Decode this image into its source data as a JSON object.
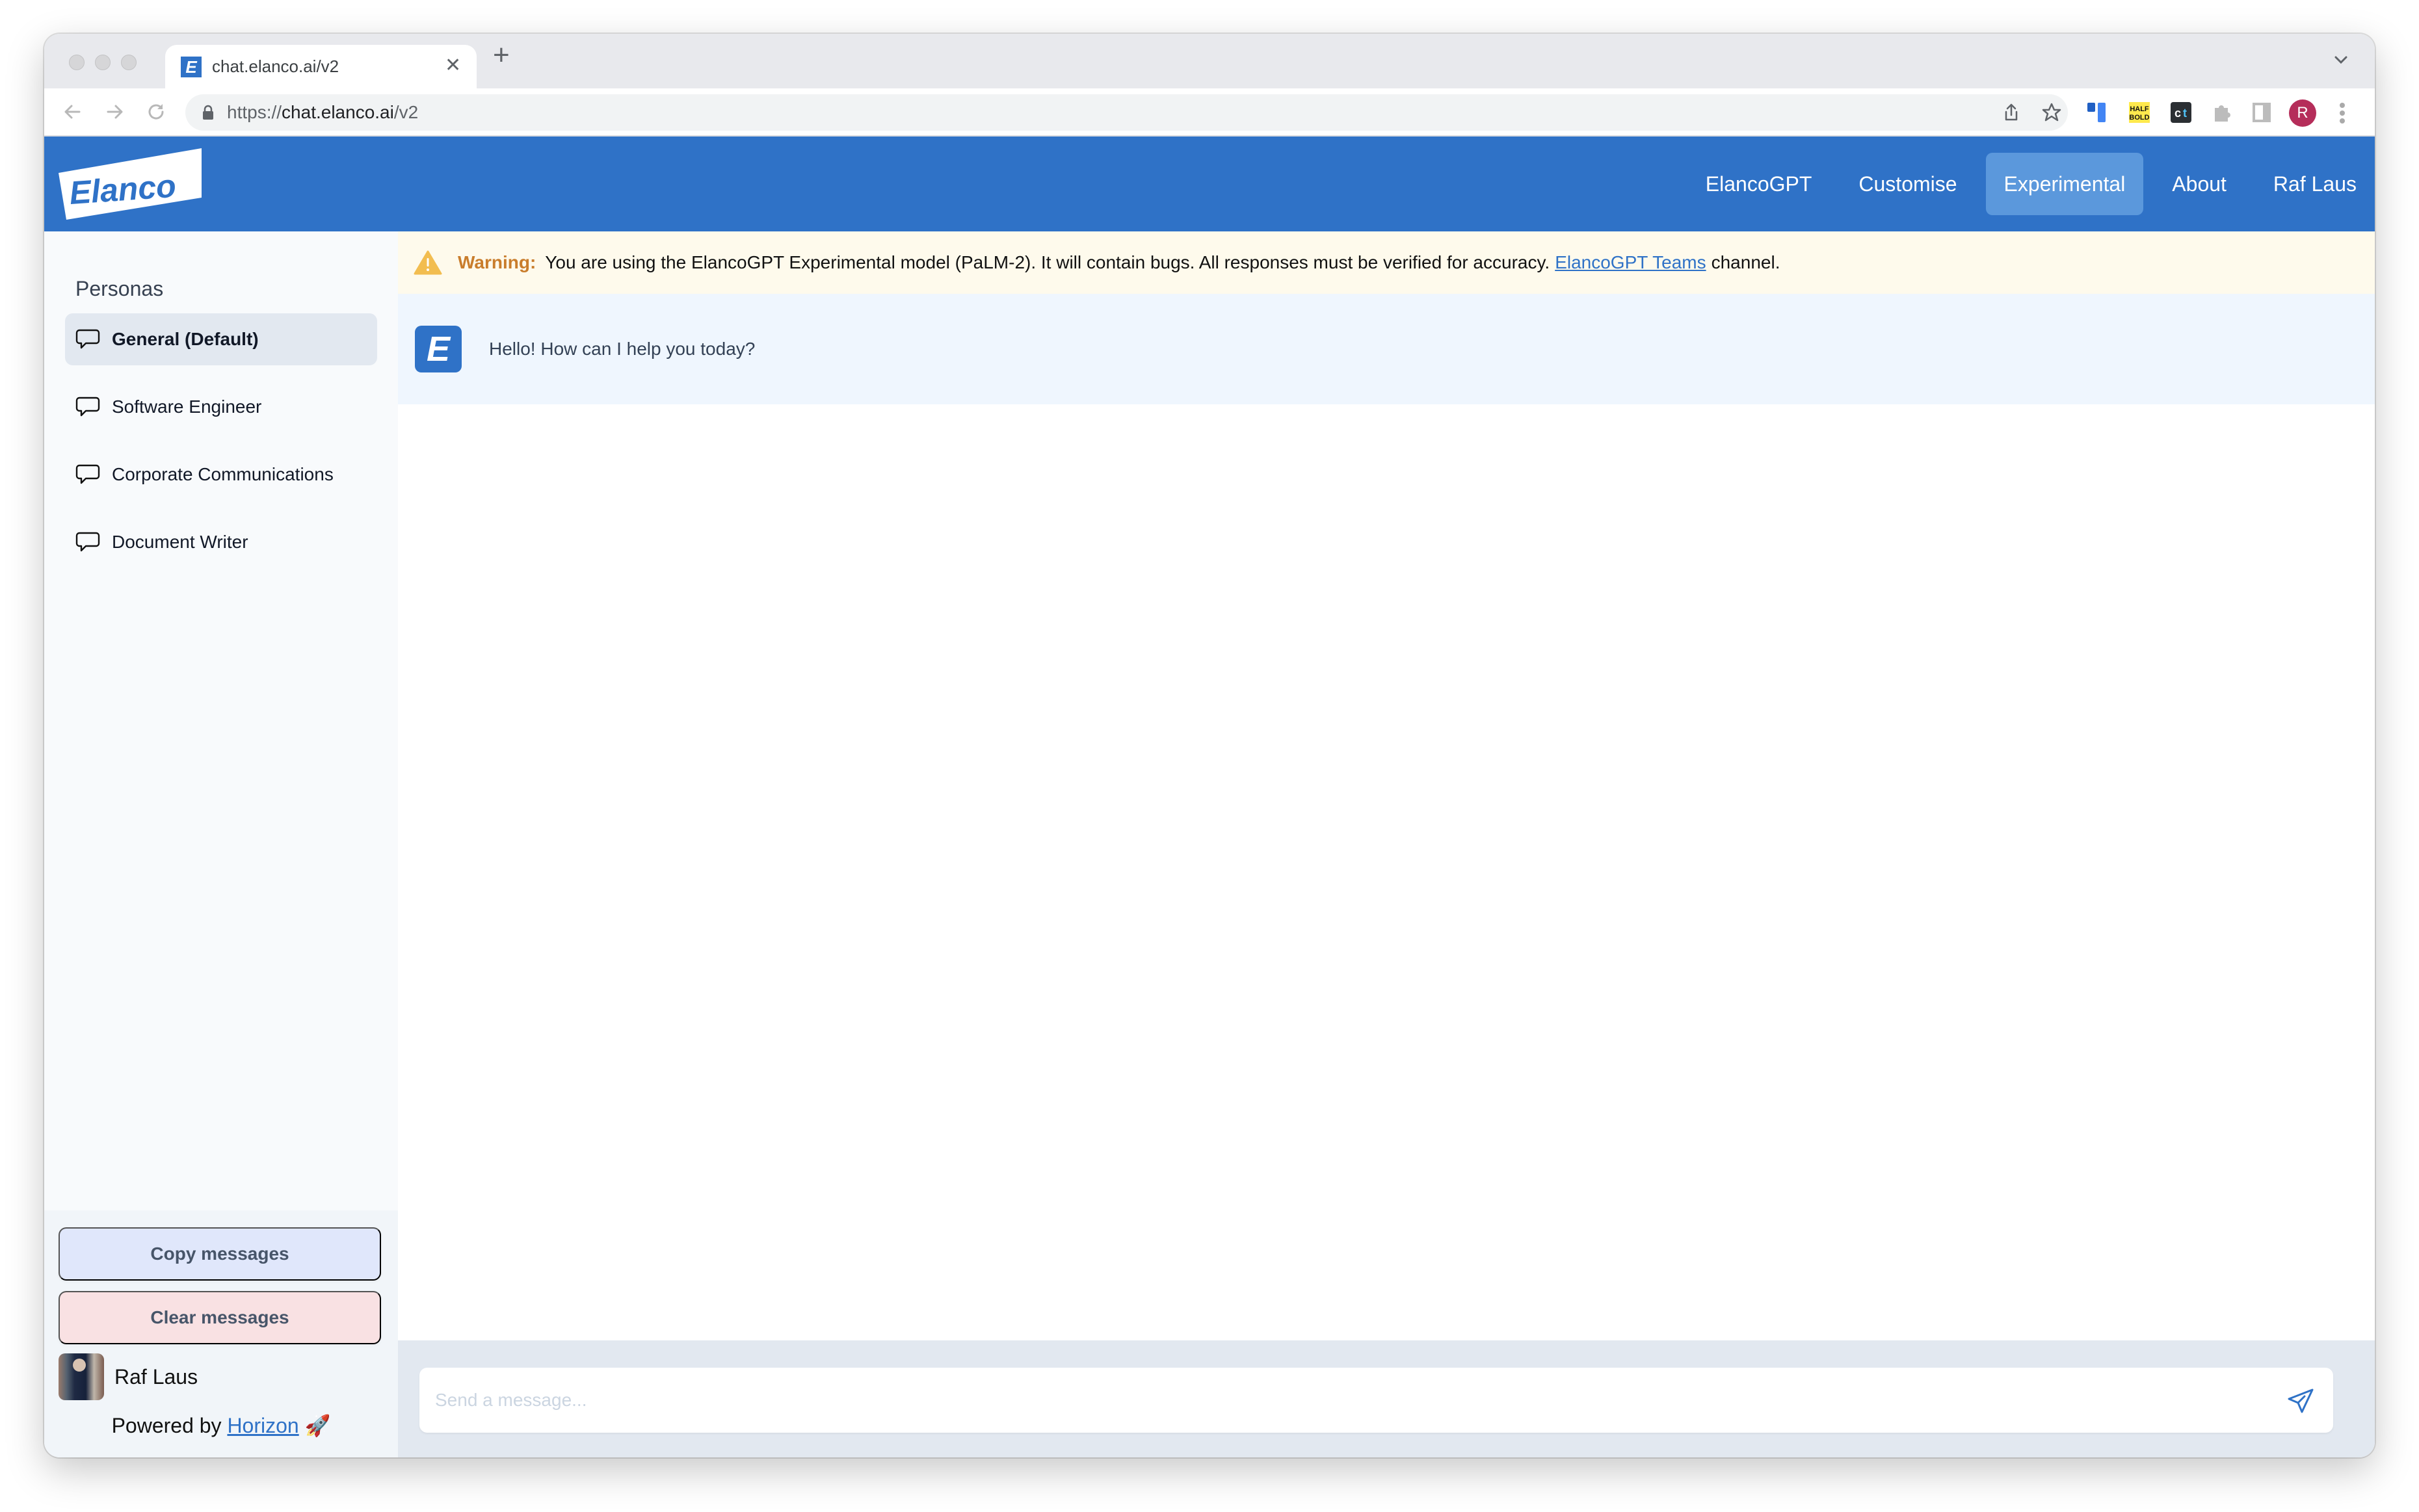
{
  "browser": {
    "tab_title": "chat.elanco.ai/v2",
    "tab_favicon_letter": "E",
    "url_scheme": "https://",
    "url_host": "chat.elanco.ai",
    "url_path": "/v2",
    "profile_initial": "R",
    "extensions": [
      "trello-icon",
      "half-bold-icon",
      "ct-icon",
      "puzzle-icon"
    ]
  },
  "header": {
    "logo_text": "Elanco",
    "nav": [
      {
        "label": "ElancoGPT",
        "active": false
      },
      {
        "label": "Customise",
        "active": false
      },
      {
        "label": "Experimental",
        "active": true
      },
      {
        "label": "About",
        "active": false
      },
      {
        "label": "Raf Laus",
        "active": false
      }
    ],
    "brand_color": "#2f72c7"
  },
  "sidebar": {
    "title": "Personas",
    "personas": [
      {
        "label": "General (Default)",
        "active": true
      },
      {
        "label": "Software Engineer",
        "active": false
      },
      {
        "label": "Corporate Communications",
        "active": false
      },
      {
        "label": "Document Writer",
        "active": false
      }
    ],
    "copy_button": "Copy messages",
    "clear_button": "Clear messages",
    "user_name": "Raf Laus",
    "powered_prefix": "Powered by",
    "powered_link": "Horizon",
    "powered_emoji": "🚀"
  },
  "warning": {
    "label": "Warning:",
    "text": "You are using the ElancoGPT Experimental model (PaLM-2). It will contain bugs. All responses must be verified for accuracy.",
    "link": "ElancoGPT Teams",
    "suffix": "channel."
  },
  "messages": [
    {
      "role": "assistant",
      "avatar_letter": "E",
      "text": "Hello! How can I help you today?"
    }
  ],
  "composer": {
    "placeholder": "Send a message...",
    "value": ""
  }
}
